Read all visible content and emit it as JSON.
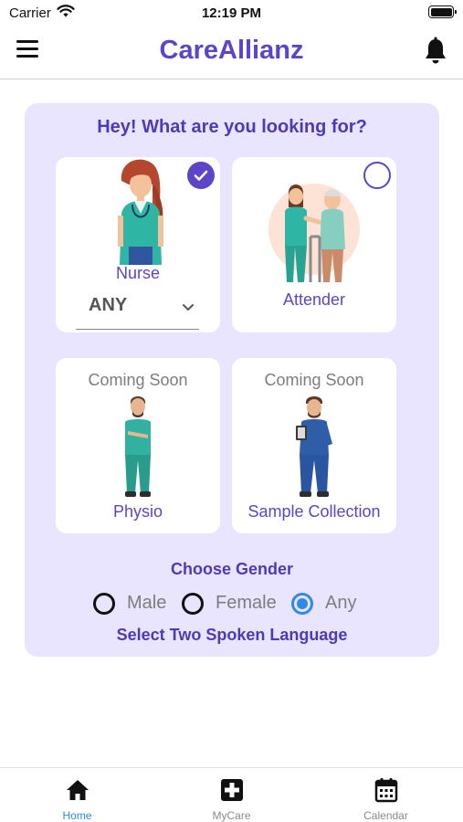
{
  "status_bar": {
    "carrier": "Carrier",
    "time": "12:19 PM",
    "wifi_icon": "wifi-icon",
    "battery_icon": "battery-icon"
  },
  "header": {
    "title": "CareAllianz",
    "menu_icon": "hamburger-menu-icon",
    "notification_icon": "bell-icon"
  },
  "main": {
    "question": "Hey! What are you looking for?",
    "services": [
      {
        "label": "Nurse",
        "selected": true,
        "coming_soon": "",
        "dropdown_value": "ANY",
        "illustration": "nurse-illustration"
      },
      {
        "label": "Attender",
        "selected": false,
        "coming_soon": "",
        "illustration": "attender-illustration"
      },
      {
        "label": "Physio",
        "coming_soon": "Coming Soon",
        "illustration": "physio-illustration"
      },
      {
        "label": "Sample Collection",
        "coming_soon": "Coming Soon",
        "illustration": "lab-technician-illustration"
      }
    ],
    "gender": {
      "title": "Choose Gender",
      "options": [
        "Male",
        "Female",
        "Any"
      ],
      "selected": "Any"
    },
    "language_title": "Select Two Spoken Language"
  },
  "tab_bar": {
    "tabs": [
      {
        "label": "Home",
        "icon": "home-icon",
        "active": true
      },
      {
        "label": "MyCare",
        "icon": "medical-plus-icon",
        "active": false
      },
      {
        "label": "Calendar",
        "icon": "calendar-icon",
        "active": false
      }
    ]
  },
  "colors": {
    "brand": "#5d44c8",
    "panel_background": "#e9e5ff",
    "active_tab": "#2e8ae6",
    "radio_selected": "#2e8ae6"
  }
}
